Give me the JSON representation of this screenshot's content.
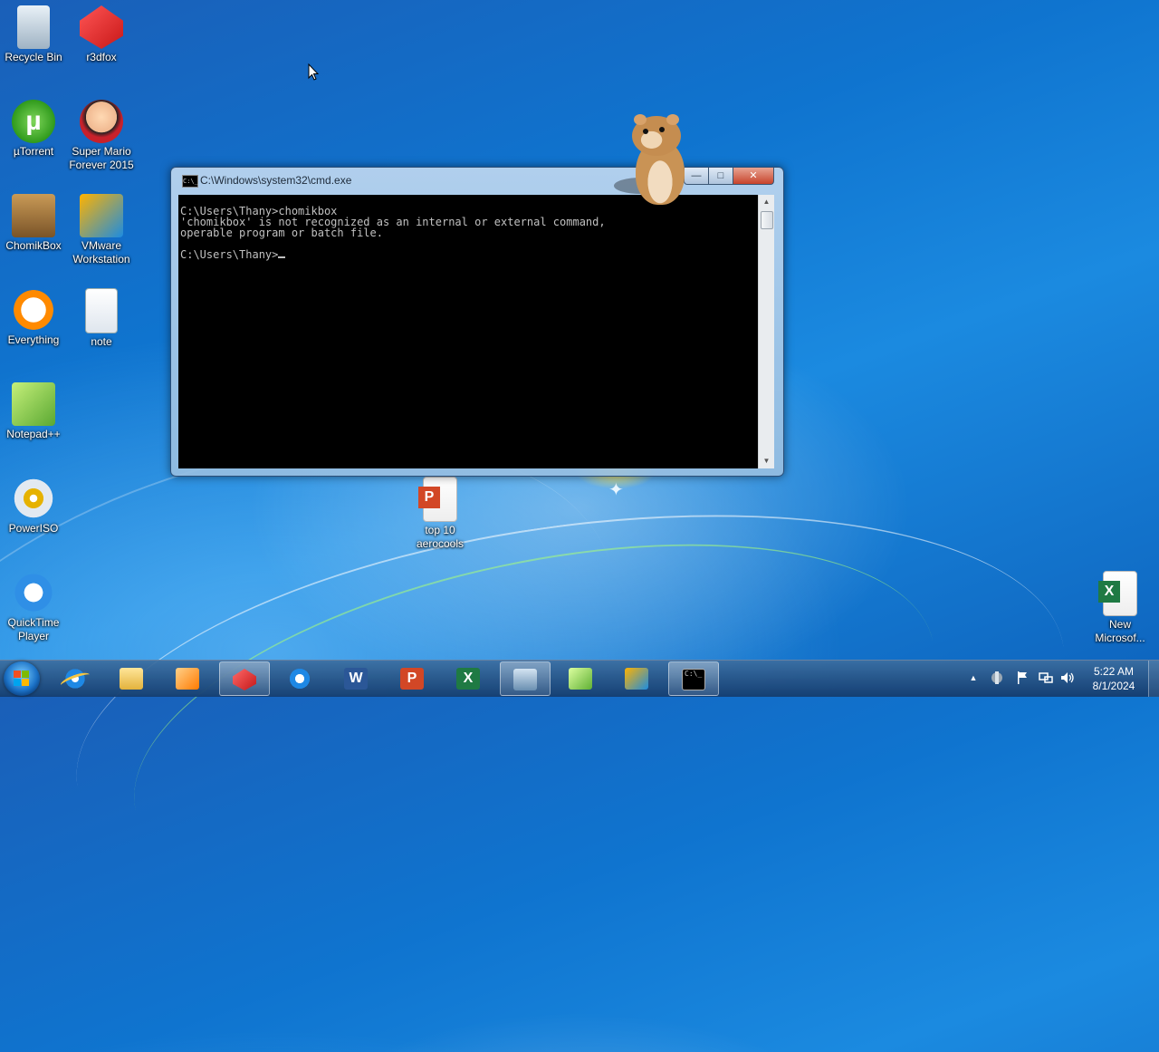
{
  "desktop": {
    "icons": [
      {
        "label": "Recycle Bin",
        "icon": "recycle-bin-icon"
      },
      {
        "label": "r3dfox",
        "icon": "r3dfox-icon"
      },
      {
        "label": "µTorrent",
        "icon": "utorrent-icon"
      },
      {
        "label": "Super Mario Forever 2015",
        "icon": "super-mario-icon"
      },
      {
        "label": "ChomikBox",
        "icon": "chomikbox-icon"
      },
      {
        "label": "VMware Workstation",
        "icon": "vmware-icon"
      },
      {
        "label": "Everything",
        "icon": "everything-icon"
      },
      {
        "label": "note",
        "icon": "text-file-icon"
      },
      {
        "label": "Notepad++",
        "icon": "notepad-plus-plus-icon"
      },
      {
        "label": "PowerISO",
        "icon": "poweriso-icon"
      },
      {
        "label": "QuickTime Player",
        "icon": "quicktime-icon"
      },
      {
        "label": "top 10 aerocools",
        "icon": "powerpoint-file-icon"
      },
      {
        "label": "New Microsof...",
        "icon": "excel-file-icon"
      }
    ]
  },
  "cmd_window": {
    "title": "C:\\Windows\\system32\\cmd.exe",
    "icon_text": "C:\\_",
    "buttons": {
      "minimize": "—",
      "maximize": "□",
      "close": "✕"
    },
    "lines": [
      "C:\\Users\\Thany>chomikbox",
      "'chomikbox' is not recognized as an internal or external command,",
      "operable program or batch file.",
      "",
      "C:\\Users\\Thany>"
    ]
  },
  "taskbar": {
    "start_label": "Start",
    "items": [
      {
        "name": "Internet Explorer",
        "icon": "internet-explorer-icon"
      },
      {
        "name": "Windows Explorer",
        "icon": "folder-icon"
      },
      {
        "name": "Windows Media Player",
        "icon": "media-player-icon"
      },
      {
        "name": "r3dfox",
        "icon": "r3dfox-icon"
      },
      {
        "name": "QuickTime Player",
        "icon": "quicktime-icon"
      },
      {
        "name": "Word",
        "icon": "word-icon",
        "glyph": "W"
      },
      {
        "name": "PowerPoint",
        "icon": "powerpoint-icon",
        "glyph": "P"
      },
      {
        "name": "Excel",
        "icon": "excel-icon",
        "glyph": "X"
      },
      {
        "name": "Remote Desktop",
        "icon": "remote-desktop-icon"
      },
      {
        "name": "Notepad++",
        "icon": "notepad-plus-plus-icon"
      },
      {
        "name": "VMware Workstation",
        "icon": "vmware-icon"
      },
      {
        "name": "Command Prompt",
        "icon": "cmd-icon",
        "glyph": "C:\\_"
      }
    ],
    "tray": {
      "overflow": "▲",
      "clock_time": "5:22 AM",
      "clock_date": "8/1/2024"
    }
  },
  "colors": {
    "console_bg": "#000000",
    "console_fg": "#c0c0c0",
    "close_button": "#c7432b"
  }
}
